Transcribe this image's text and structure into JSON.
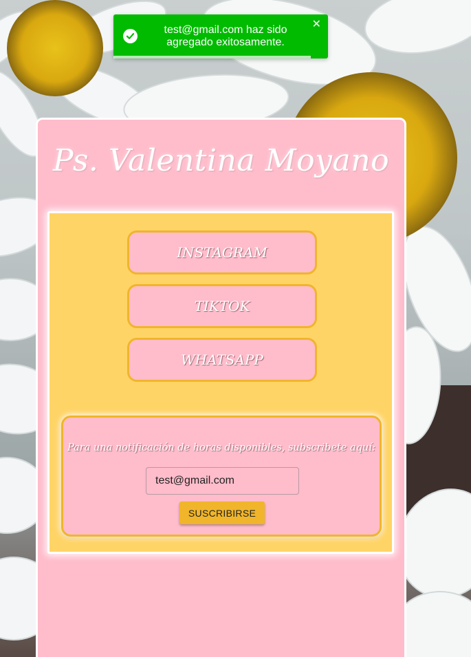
{
  "toast": {
    "message": "test@gmail.com haz sido agregado exitosamente.",
    "close_glyph": "✕",
    "icon": "check-circle-icon",
    "color": "#00bb00"
  },
  "page": {
    "title": "Ps. Valentina Moyano"
  },
  "social_links": [
    {
      "label": "INSTAGRAM"
    },
    {
      "label": "TIKTOK"
    },
    {
      "label": "WHATSAPP"
    }
  ],
  "subscribe": {
    "prompt": "Para una notificación de horas disponibles, subscribete aquí:",
    "email_value": "test@gmail.com",
    "button_label": "SUSCRIBIRSE"
  },
  "colors": {
    "card_pink": "#ffbccb",
    "panel_yellow": "#ffd466",
    "accent_gold": "#f0b52b"
  }
}
